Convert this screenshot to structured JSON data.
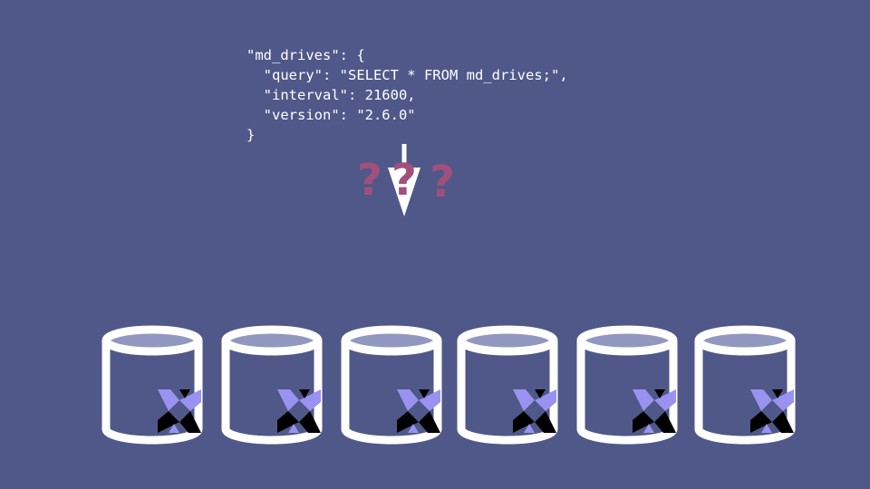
{
  "config": {
    "lines": [
      "\"md_drives\": {",
      "  \"query\": \"SELECT * FROM md_drives;\",",
      "  \"interval\": 21600,",
      "  \"version\": \"2.6.0\"",
      "}"
    ]
  },
  "uncertainty": {
    "marks": [
      "?",
      "?",
      "?"
    ],
    "color": "#a0507a"
  },
  "colors": {
    "background": "#4f5888",
    "database_stroke": "#ffffff",
    "database_top_fill": "#9297c0",
    "logo_light": "#9a92f0",
    "logo_dark": "#000000"
  },
  "hosts": {
    "count": 6,
    "icon": "database-icon",
    "logo_icon": "osquery-logo-icon"
  }
}
